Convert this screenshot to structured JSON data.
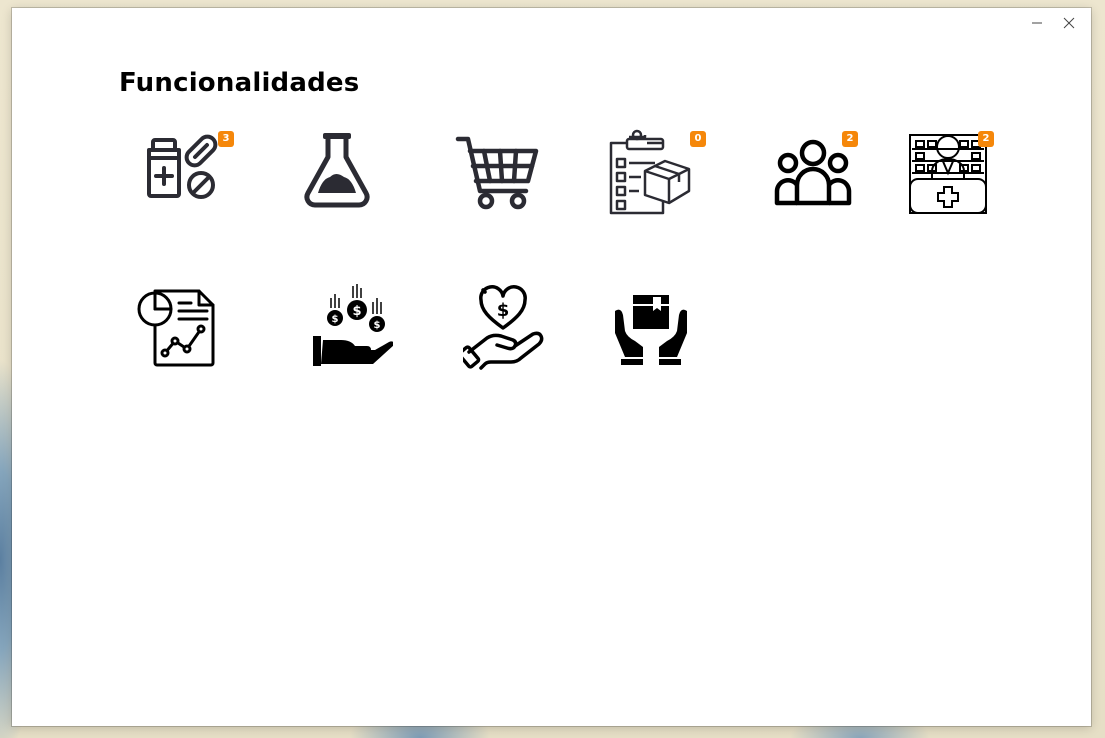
{
  "window": {
    "controls": [
      "minimize-icon",
      "close-icon"
    ]
  },
  "page": {
    "title": "Funcionalidades"
  },
  "tiles": [
    {
      "icon": "medicines-icon",
      "badge": "3"
    },
    {
      "icon": "laboratory-flask-icon"
    },
    {
      "icon": "shopping-cart-icon"
    },
    {
      "icon": "inventory-checklist-icon",
      "badge": "0"
    },
    {
      "icon": "users-group-icon",
      "badge": "2"
    },
    {
      "icon": "pharmacist-icon",
      "badge": "2"
    },
    {
      "icon": "report-analytics-icon"
    },
    {
      "icon": "income-money-hand-icon"
    },
    {
      "icon": "donation-hand-icon"
    },
    {
      "icon": "delivery-package-hands-icon"
    }
  ],
  "colors": {
    "badge": "#f5870a",
    "icon_dark": "#2b2b33"
  }
}
